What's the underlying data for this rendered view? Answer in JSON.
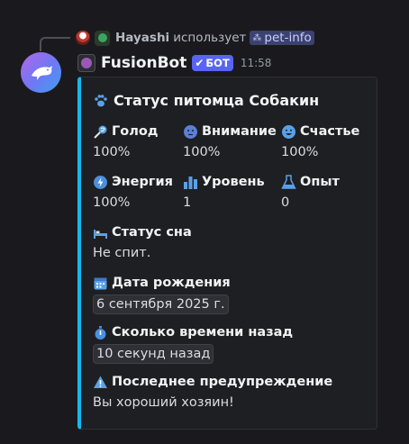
{
  "reply": {
    "username": "Hayashi",
    "verb": "использует",
    "command": "pet-info"
  },
  "message": {
    "author": "FusionBot",
    "bot_tag": "БОТ",
    "timestamp": "11:58"
  },
  "embed": {
    "accent_color": "#14b8ef",
    "title": "Статус питомца Собакин",
    "fields": {
      "hunger": {
        "name": "Голод",
        "value": "100%",
        "icon": "lollipop-icon"
      },
      "attention": {
        "name": "Внимание",
        "value": "100%",
        "icon": "face-icon"
      },
      "happiness": {
        "name": "Счастье",
        "value": "100%",
        "icon": "smile-icon"
      },
      "energy": {
        "name": "Энергия",
        "value": "100%",
        "icon": "lightning-icon"
      },
      "level": {
        "name": "Уровень",
        "value": "1",
        "icon": "bar-chart-icon"
      },
      "experience": {
        "name": "Опыт",
        "value": "0",
        "icon": "flask-icon"
      },
      "sleep": {
        "name": "Статус сна",
        "value": "Не спит.",
        "icon": "bed-icon"
      },
      "birthday": {
        "name": "Дата рождения",
        "value": "6 сентября 2025 г.",
        "icon": "calendar-icon"
      },
      "elapsed": {
        "name": "Сколько времени назад",
        "value": "10 секунд назад",
        "icon": "stopwatch-icon"
      },
      "warning": {
        "name": "Последнее предупреждение",
        "value": "Вы хороший хозяин!",
        "icon": "warning-icon"
      }
    }
  }
}
